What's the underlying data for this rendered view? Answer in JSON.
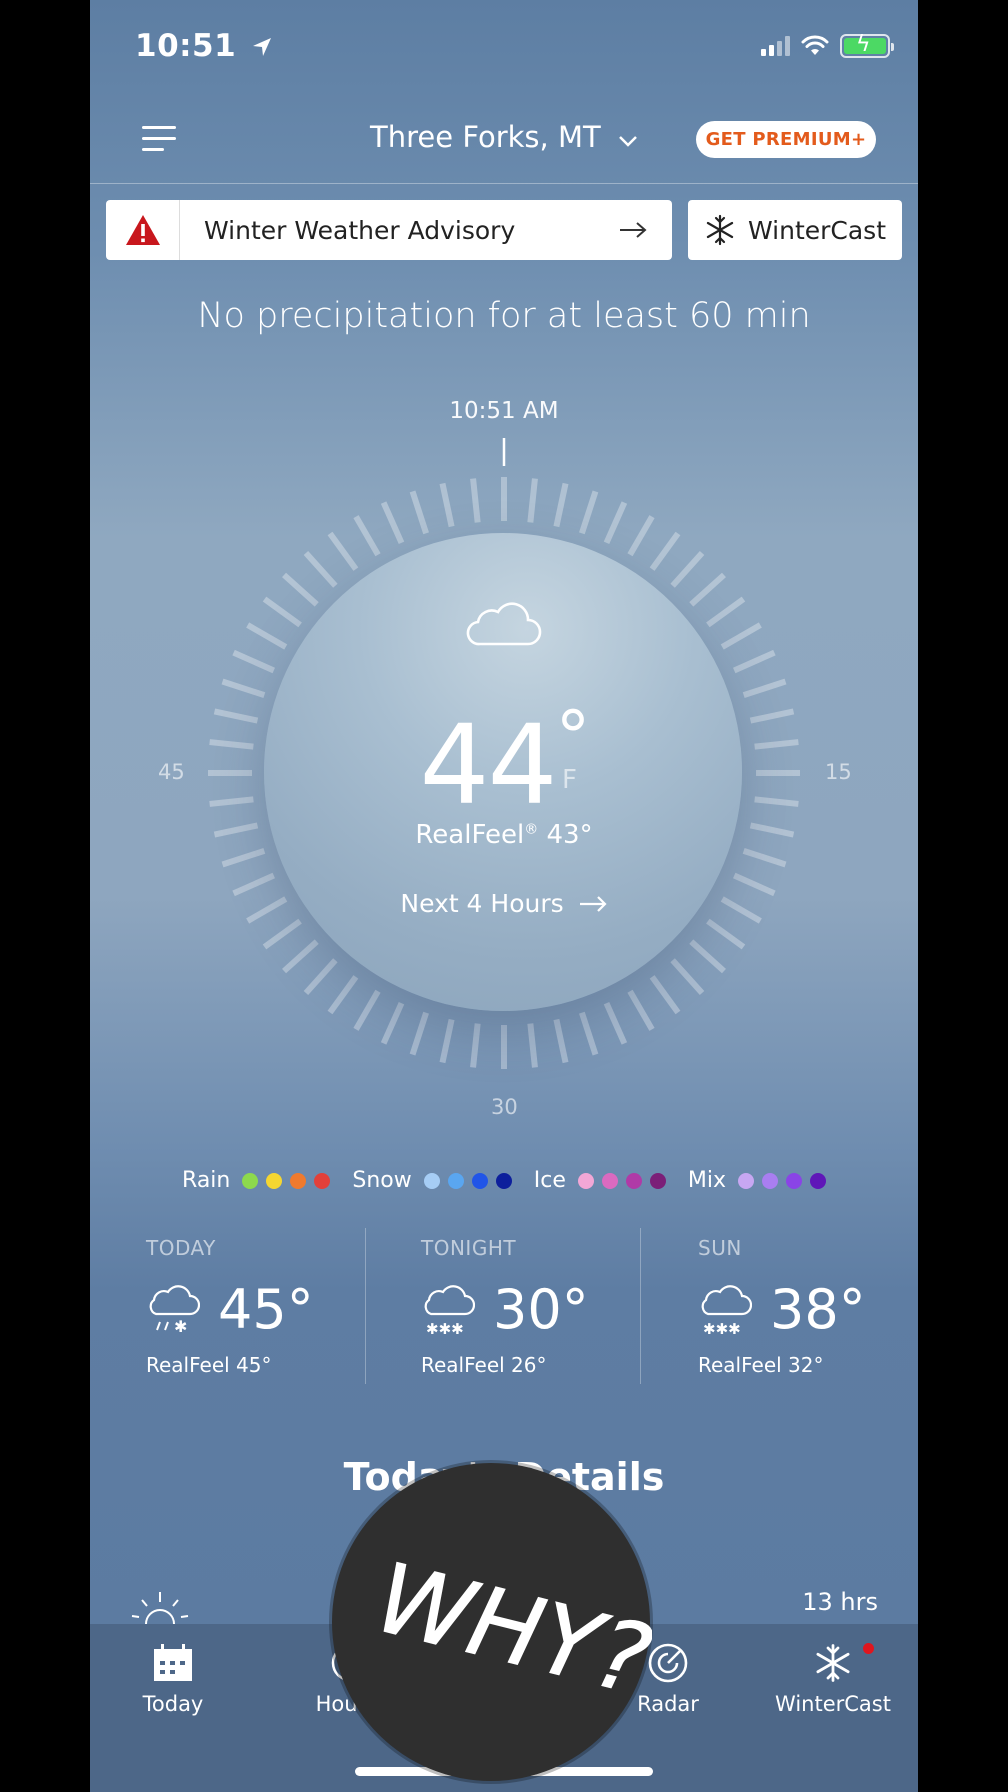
{
  "status_bar": {
    "time": "10:51"
  },
  "header": {
    "location": "Three Forks, MT",
    "premium_label": "GET PREMIUM+"
  },
  "alerts": {
    "advisory_label": "Winter Weather Advisory",
    "wintercast_label": "WinterCast"
  },
  "minutecast": {
    "summary": "No precipitation for at least 60 min",
    "current_time": "10:51 AM",
    "markers": {
      "left": "45",
      "right": "15",
      "bottom": "30"
    },
    "icon": "cloud-icon"
  },
  "current": {
    "temperature": "44",
    "degree_symbol": "°",
    "unit": "F",
    "realfeel_prefix": "RealFeel",
    "realfeel_mark": "®",
    "realfeel_value": "43°",
    "next_hours_label": "Next 4 Hours"
  },
  "legend": [
    {
      "label": "Rain",
      "colors": [
        "#8dd94d",
        "#f5d631",
        "#ef7a2e",
        "#e2403a"
      ]
    },
    {
      "label": "Snow",
      "colors": [
        "#a6cdf5",
        "#5aa6f0",
        "#2155e8",
        "#0d1f9c"
      ]
    },
    {
      "label": "Ice",
      "colors": [
        "#f2a7d6",
        "#db6ac0",
        "#b03aa7",
        "#7b1f78"
      ]
    },
    {
      "label": "Mix",
      "colors": [
        "#c7a7f2",
        "#a97ef0",
        "#8a44e6",
        "#5f17b8"
      ]
    }
  ],
  "forecast": [
    {
      "day": "TODAY",
      "temp": "45°",
      "realfeel": "RealFeel 45°",
      "icon": "rain-snow-icon"
    },
    {
      "day": "TONIGHT",
      "temp": "30°",
      "realfeel": "RealFeel 26°",
      "icon": "snow-cloud-icon"
    },
    {
      "day": "SUN",
      "temp": "38°",
      "realfeel": "RealFeel 32°",
      "icon": "snow-cloud-icon"
    }
  ],
  "details": {
    "title": "Today's Details",
    "daylight": "13 hrs"
  },
  "nav": {
    "today": "Today",
    "hourly": "Hourly",
    "radar": "Radar",
    "wintercast": "WinterCast"
  },
  "sticker": {
    "text": "WHY?"
  },
  "colors": {
    "premium_text": "#e35b1c",
    "alert_red": "#c8171d",
    "nav_bg": "#4d6788"
  }
}
